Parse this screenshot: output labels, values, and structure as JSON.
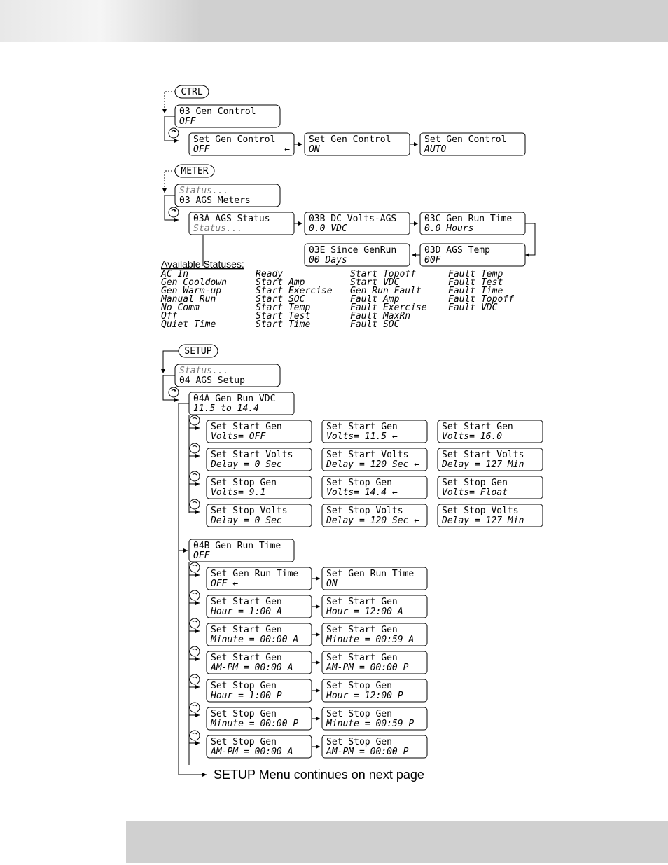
{
  "ctrl": {
    "title": "CTRL",
    "menu": {
      "l1": "03 Gen Control",
      "l2": "OFF"
    },
    "row": [
      {
        "l1": "Set Gen Control",
        "l2": "OFF"
      },
      {
        "l1": "Set Gen Control",
        "l2": "ON"
      },
      {
        "l1": "Set Gen Control",
        "l2": "AUTO"
      }
    ]
  },
  "meter": {
    "title": "METER",
    "menu": {
      "l1": "Status...",
      "l2": "03 AGS Meters"
    },
    "row1": [
      {
        "l1": "03A AGS Status",
        "l2": "Status..."
      },
      {
        "l1": "03B DC Volts-AGS",
        "l2": "0.0 VDC"
      },
      {
        "l1": "03C Gen Run Time",
        "l2": "0.0 Hours"
      }
    ],
    "row2": [
      {
        "l1": "03E Since GenRun",
        "l2": "00 Days"
      },
      {
        "l1": "03D AGS Temp",
        "l2": "00F"
      }
    ],
    "avail_label": "Available Statuses:",
    "statuses": {
      "c1": [
        "AC In",
        "Gen Cooldown",
        "Gen Warm-up",
        "Manual Run",
        "No Comm",
        "Off",
        "Quiet Time"
      ],
      "c2": [
        "Ready",
        "Start Amp",
        "Start Exercise",
        "Start SOC",
        "Start Temp",
        "Start Test",
        "Start Time"
      ],
      "c3": [
        "Start Topoff",
        "Start VDC",
        "Gen Run Fault",
        "Fault Amp",
        "Fault Exercise",
        "Fault MaxRn",
        "Fault SOC"
      ],
      "c4": [
        "Fault Temp",
        "Fault Test",
        "Fault Time",
        "Fault Topoff",
        "Fault VDC"
      ]
    }
  },
  "setup": {
    "title": "SETUP",
    "menu": {
      "l1": "Status...",
      "l2": "04 AGS Setup"
    },
    "a": {
      "head": {
        "l1": "04A Gen Run VDC",
        "l2": "11.5 to 14.4"
      },
      "rows": [
        [
          {
            "l1": "Set Start Gen",
            "l2": "Volts= OFF"
          },
          {
            "l1": "Set Start Gen",
            "l2": "Volts= 11.5   ←"
          },
          {
            "l1": "Set Start Gen",
            "l2": "Volts= 16.0"
          }
        ],
        [
          {
            "l1": "Set Start Volts",
            "l2": "Delay =   0 Sec"
          },
          {
            "l1": "Set Start Volts",
            "l2": "Delay = 120 Sec ←"
          },
          {
            "l1": "Set Start Volts",
            "l2": "Delay = 127 Min"
          }
        ],
        [
          {
            "l1": "Set Stop Gen",
            "l2": "Volts=  9.1"
          },
          {
            "l1": "Set Stop Gen",
            "l2": "Volts= 14.4   ←"
          },
          {
            "l1": "Set Stop Gen",
            "l2": "Volts= Float"
          }
        ],
        [
          {
            "l1": "Set Stop Volts",
            "l2": "Delay =   0 Sec"
          },
          {
            "l1": "Set Stop Volts",
            "l2": "Delay = 120 Sec ←"
          },
          {
            "l1": "Set Stop Volts",
            "l2": "Delay = 127 Min"
          }
        ]
      ]
    },
    "b": {
      "head": {
        "l1": "04B Gen Run Time",
        "l2": "OFF"
      },
      "rows": [
        [
          {
            "l1": "Set Gen Run Time",
            "l2": "OFF           ←"
          },
          {
            "l1": "Set Gen Run Time",
            "l2": "ON"
          }
        ],
        [
          {
            "l1": "Set Start Gen",
            "l2": "Hour   =  1:00  A"
          },
          {
            "l1": "Set Start Gen",
            "l2": "Hour   = 12:00  A"
          }
        ],
        [
          {
            "l1": "Set Start Gen",
            "l2": "Minute =  00:00 A"
          },
          {
            "l1": "Set Start Gen",
            "l2": "Minute =  00:59 A"
          }
        ],
        [
          {
            "l1": "Set Start Gen",
            "l2": "AM-PM  =  00:00 A"
          },
          {
            "l1": "Set Start Gen",
            "l2": "AM-PM  =  00:00 P"
          }
        ],
        [
          {
            "l1": "Set Stop Gen",
            "l2": "Hour   =  1:00  P"
          },
          {
            "l1": "Set Stop Gen",
            "l2": "Hour   = 12:00  P"
          }
        ],
        [
          {
            "l1": "Set Stop Gen",
            "l2": "Minute = 00:00  P"
          },
          {
            "l1": "Set Stop Gen",
            "l2": "Minute = 00:59  P"
          }
        ],
        [
          {
            "l1": "Set Stop Gen",
            "l2": "AM-PM  = 00:00  A"
          },
          {
            "l1": "Set Stop Gen",
            "l2": "AM-PM  = 00:00  P"
          }
        ]
      ]
    },
    "continue": "SETUP Menu continues on next page"
  }
}
